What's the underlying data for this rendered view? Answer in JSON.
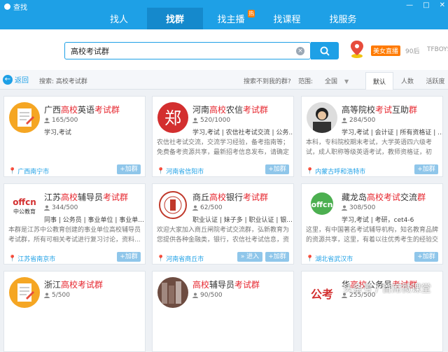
{
  "window": {
    "title": "查找",
    "controls": [
      "—",
      "□",
      "✕"
    ]
  },
  "nav": {
    "tabs": [
      {
        "label": "找人",
        "active": false
      },
      {
        "label": "找群",
        "active": true
      },
      {
        "label": "找主播",
        "active": false,
        "badge": "热"
      },
      {
        "label": "找课程",
        "active": false
      },
      {
        "label": "找服务",
        "active": false
      }
    ]
  },
  "search": {
    "value": "高校考试群",
    "clear_icon": "×"
  },
  "live": {
    "badge": "美女直播",
    "extra": "90后",
    "extra2": "TFBOYS"
  },
  "filter": {
    "back_label": "返回",
    "crumb": "搜索: 高校考试群",
    "not_found": "搜索不到我的群?",
    "range_label": "范围:",
    "range_value": "全国",
    "sort_tabs": [
      {
        "label": "默认",
        "active": true
      },
      {
        "label": "人数",
        "active": false
      },
      {
        "label": "活跃度",
        "active": false
      }
    ]
  },
  "cards": [
    {
      "name_parts": [
        [
          "广西",
          0
        ],
        [
          "高校",
          1
        ],
        [
          "英语",
          0
        ],
        [
          "考试群",
          1
        ]
      ],
      "members": "165/500",
      "tags": "学习,考试",
      "desc": "",
      "location": "广西南宁市",
      "join": "+加群",
      "logo": "exam-paper"
    },
    {
      "name_parts": [
        [
          "河南",
          0
        ],
        [
          "高校",
          1
        ],
        [
          "农信",
          0
        ],
        [
          "考试群",
          1
        ]
      ],
      "members": "520/1000",
      "tags": "学习,考试 | 农信社考试交流 | 公务...",
      "desc": "农信社考试交流，交流学习经验，备考指南等；免费备考资源共享，最新招考信息发布，请确定认...",
      "location": "河南省信阳市",
      "join": "+加群",
      "logo": "zheng"
    },
    {
      "name_parts": [
        [
          "高等院校",
          0
        ],
        [
          "考试",
          1
        ],
        [
          "互助",
          0
        ],
        [
          "群",
          1
        ]
      ],
      "members": "284/500",
      "tags": "学习,考试 | 会计证 | 所有资格证 | ...",
      "desc": "本科，专科院校期末考试，大学英语四六级考试，成人职称等级英语考试，教师资格证，初级，中...",
      "location": "内蒙古呼和浩特市",
      "join": "+加群",
      "logo": "portrait"
    },
    {
      "name_parts": [
        [
          "江苏",
          0
        ],
        [
          "高校",
          1
        ],
        [
          "辅导员",
          0
        ],
        [
          "考试群",
          1
        ]
      ],
      "members": "344/500",
      "tags": "同事 | 公务员 | 事业单位 | 事业单...",
      "desc": "本群是江苏中公教育创建的事业单位高校辅导员考试群，所有可相关考试进行复习讨论，资料...",
      "location": "江苏省南京市",
      "join": "+加群",
      "logo": "offcn"
    },
    {
      "name_parts": [
        [
          "商丘",
          0
        ],
        [
          "高校",
          1
        ],
        [
          "银行",
          0
        ],
        [
          "考试群",
          1
        ]
      ],
      "members": "62/500",
      "tags": "职业认证 | 妹子多 | 职业认证 | 银...",
      "desc": "欢迎大家加入商丘闸院考试交流群，弘新教育为您提供各种金融类，银行，农信社考试信息，资料...",
      "location": "河南省商丘市",
      "join": "+加群",
      "enter": "进入",
      "logo": "seal"
    },
    {
      "name_parts": [
        [
          "藏龙岛",
          0
        ],
        [
          "高校",
          1
        ],
        [
          "考试",
          1
        ],
        [
          "交流",
          0
        ],
        [
          "群",
          1
        ]
      ],
      "members": "308/500",
      "tags": "学习,考试 | 考研，cet4-6",
      "desc": "这里，有中国著名考试辅导机构，知名教育品牌的资源共享，这里，有着以往优秀考生的经验交流...",
      "location": "湖北省武汉市",
      "join": "+加群",
      "logo": "offcn-green"
    },
    {
      "name_parts": [
        [
          "浙江",
          0
        ],
        [
          "高校",
          1
        ],
        [
          "考试群",
          1
        ]
      ],
      "members": "5/500",
      "tags": "",
      "desc": "",
      "location": "",
      "join": "",
      "logo": "exam-paper"
    },
    {
      "name_parts": [
        [
          "高校",
          1
        ],
        [
          "辅导员",
          0
        ],
        [
          "考试群",
          1
        ]
      ],
      "members": "90/500",
      "tags": "",
      "desc": "",
      "location": "",
      "join": "",
      "logo": "books"
    },
    {
      "name_parts": [
        [
          "华",
          0
        ],
        [
          "高校",
          1
        ],
        [
          "公务员",
          0
        ],
        [
          "考试",
          1
        ],
        [
          "群",
          1
        ]
      ],
      "members": "255/500",
      "tags": "",
      "desc": "",
      "location": "",
      "join": "",
      "logo": "gongkao"
    }
  ],
  "watermark": "头条号 / 首席微课堂"
}
